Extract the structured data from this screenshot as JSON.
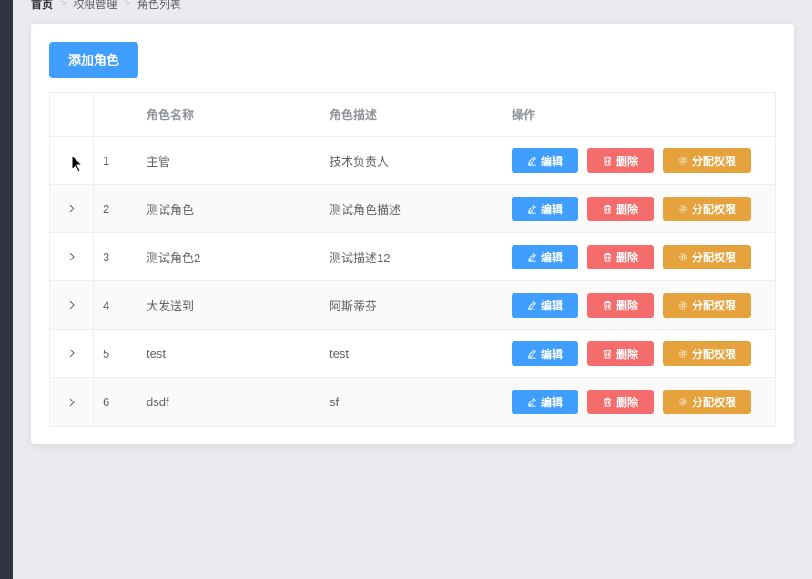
{
  "breadcrumb": {
    "home": "首页",
    "level1": "权限管理",
    "level2": "角色列表"
  },
  "toolbar": {
    "add_label": "添加角色"
  },
  "table": {
    "headers": {
      "index": "",
      "name": "角色名称",
      "desc": "角色描述",
      "ops": "操作"
    },
    "rows": [
      {
        "index": "1",
        "name": "主管",
        "desc": "技术负责人"
      },
      {
        "index": "2",
        "name": "测试角色",
        "desc": "测试角色描述"
      },
      {
        "index": "3",
        "name": "测试角色2",
        "desc": "测试描述12"
      },
      {
        "index": "4",
        "name": "大发送到",
        "desc": "阿斯蒂芬"
      },
      {
        "index": "5",
        "name": "test",
        "desc": "test"
      },
      {
        "index": "6",
        "name": "dsdf",
        "desc": "sf"
      }
    ],
    "ops": {
      "edit": "编辑",
      "delete": "删除",
      "assign": "分配权限"
    }
  },
  "colors": {
    "primary": "#409eff",
    "danger": "#f56c6c",
    "warning": "#e6a23c"
  }
}
